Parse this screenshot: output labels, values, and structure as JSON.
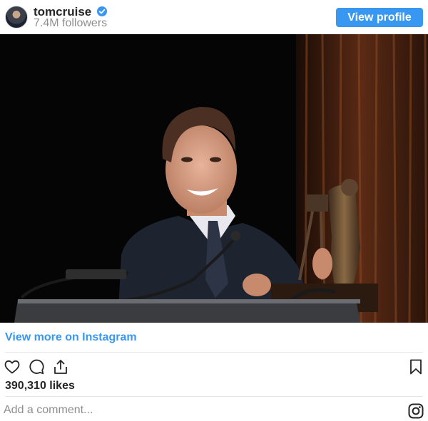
{
  "header": {
    "username": "tomcruise",
    "followers": "7.4M followers",
    "view_profile_label": "View profile",
    "verified_icon": "verified-badge-icon",
    "accent_color": "#3897f0"
  },
  "post": {
    "image_alt": "tomcruise post"
  },
  "links": {
    "view_more": "View more on Instagram"
  },
  "actions": {
    "icons": [
      "heart-icon",
      "comment-icon",
      "share-icon",
      "bookmark-icon"
    ]
  },
  "likes": "390,310 likes",
  "comment": {
    "placeholder": "Add a comment...",
    "icon": "instagram-icon"
  }
}
